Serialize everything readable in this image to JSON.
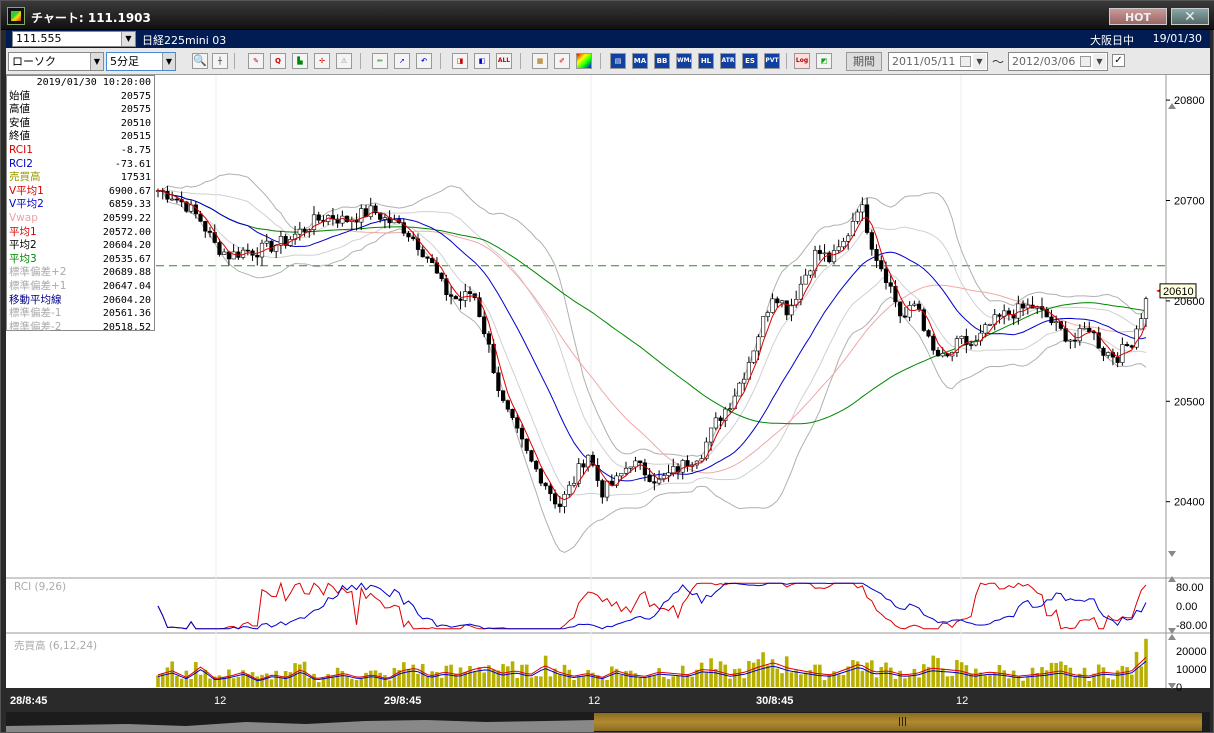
{
  "window": {
    "title": "チャート: 111.1903",
    "hot_label": "HOT",
    "close_label": "✕"
  },
  "symbol_row": {
    "code": "111.555",
    "name": "日経225mini 03",
    "market": "大阪日中",
    "date": "19/01/30"
  },
  "toolbar": {
    "chart_type": "ローソク",
    "interval": "5分足",
    "period_label": "期間",
    "date_from": "2011/05/11",
    "date_to": "2012/03/06",
    "tilde": "〜",
    "check": "✓",
    "buttons": [
      "MA",
      "BB",
      "WMA",
      "HL",
      "ATR",
      "ES",
      "PVT",
      "Log"
    ]
  },
  "info": {
    "datetime": "2019/01/30  10:20:00",
    "rows": [
      {
        "label": "始値",
        "value": "20575",
        "color": "#000000"
      },
      {
        "label": "高値",
        "value": "20575",
        "color": "#000000"
      },
      {
        "label": "安値",
        "value": "20510",
        "color": "#000000"
      },
      {
        "label": "終値",
        "value": "20515",
        "color": "#000000"
      },
      {
        "label": "RCI1",
        "value": "-8.75",
        "color": "#dd0000"
      },
      {
        "label": "RCI2",
        "value": "-73.61",
        "color": "#0000cc"
      },
      {
        "label": "売買高",
        "value": "17531",
        "color": "#999900"
      },
      {
        "label": "V平均1",
        "value": "6900.67",
        "color": "#dd0000"
      },
      {
        "label": "V平均2",
        "value": "6859.33",
        "color": "#0000cc"
      },
      {
        "label": "Vwap",
        "value": "20599.22",
        "color": "#f0a0a0"
      },
      {
        "label": "平均1",
        "value": "20572.00",
        "color": "#dd0000"
      },
      {
        "label": "平均2",
        "value": "20604.20",
        "color": "#000000"
      },
      {
        "label": "平均3",
        "value": "20535.67",
        "color": "#008800"
      },
      {
        "label": "標準偏差+2",
        "value": "20689.88",
        "color": "#aaaaaa"
      },
      {
        "label": "標準偏差+1",
        "value": "20647.04",
        "color": "#aaaaaa"
      },
      {
        "label": "移動平均線",
        "value": "20604.20",
        "color": "#00008b"
      },
      {
        "label": "標準偏差-1",
        "value": "20561.36",
        "color": "#aaaaaa"
      },
      {
        "label": "標準偏差-2",
        "value": "20518.52",
        "color": "#aaaaaa"
      }
    ]
  },
  "chart_data": {
    "type": "candlestick",
    "y_ticks": [
      "20800",
      "20700",
      "20600",
      "20500",
      "20400"
    ],
    "last_price_tag": "20610",
    "ylim": [
      20325,
      20825
    ],
    "dashed_level": 20635,
    "x_labels": [
      "28/8:45",
      "12",
      "29/8:45",
      "12",
      "30/8:45",
      "12"
    ],
    "rci_label": "RCI (9,26)",
    "rci_ticks": [
      "80.00",
      "0.00",
      "-80.00"
    ],
    "volume_label": "売買高 (6,12,24)",
    "volume_ticks": [
      "20000",
      "10000",
      "0"
    ],
    "price_path": [
      20710,
      20705,
      20695,
      20680,
      20655,
      20645,
      20650,
      20650,
      20655,
      20660,
      20670,
      20680,
      20685,
      20680,
      20685,
      20690,
      20680,
      20675,
      20660,
      20640,
      20610,
      20600,
      20610,
      20560,
      20500,
      20470,
      20440,
      20420,
      20395,
      20420,
      20450,
      20410,
      20420,
      20440,
      20430,
      20420,
      20430,
      20440,
      20450,
      20480,
      20500,
      20530,
      20570,
      20610,
      20590,
      20620,
      20650,
      20640,
      20660,
      20700,
      20650,
      20620,
      20580,
      20600,
      20550,
      20540,
      20560,
      20555,
      20575,
      20585,
      20590,
      20595,
      20585,
      20570,
      20560,
      20575,
      20550,
      20545,
      20560,
      20600
    ],
    "volume_values": [
      9000,
      12000,
      7000,
      15000,
      6000,
      8000,
      11000,
      5000,
      9000,
      7000,
      13000,
      6000,
      8000,
      10000,
      7000,
      9000,
      6000,
      12000,
      14000,
      8000,
      11000,
      9000,
      13000,
      15000,
      10000,
      12000,
      9000,
      16000,
      11000,
      8000,
      10000,
      7000,
      12000,
      9000,
      8000,
      11000,
      10000,
      9000,
      13000,
      12000,
      9000,
      11000,
      15000,
      18000,
      14000,
      12000,
      10000,
      9000,
      13000,
      17000,
      11000,
      12000,
      9000,
      10000,
      14000,
      13000,
      12000,
      9000,
      11000,
      10000,
      8000,
      9000,
      10000,
      12000,
      9000,
      8000,
      11000,
      10000,
      12000,
      22000
    ]
  }
}
